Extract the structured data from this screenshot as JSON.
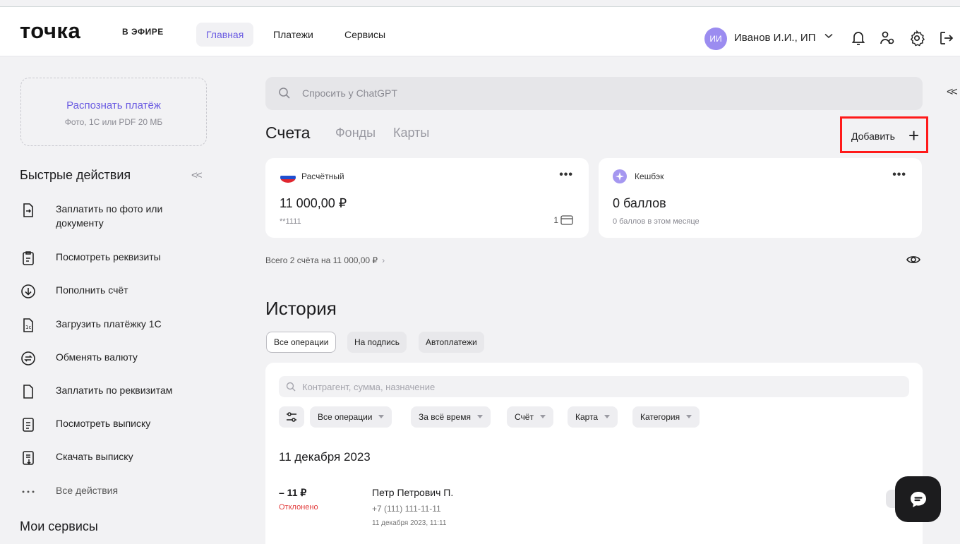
{
  "header": {
    "logo": "точка",
    "on_air": "В ЭФИРЕ",
    "tabs": [
      {
        "label": "Главная",
        "active": true
      },
      {
        "label": "Платежи",
        "active": false
      },
      {
        "label": "Сервисы",
        "active": false
      }
    ],
    "user": {
      "initials": "ИИ",
      "name": "Иванов И.И., ИП"
    },
    "icons": [
      "bell-icon",
      "users-icon",
      "gear-icon",
      "logout-icon"
    ]
  },
  "sidebar": {
    "recognize": {
      "title": "Распознать платёж",
      "subtitle": "Фото, 1С или PDF 20 МБ"
    },
    "quick_actions_title": "Быстрые действия",
    "quick_actions": [
      {
        "label": "Заплатить по фото или документу",
        "icon": "scan-document-icon"
      },
      {
        "label": "Посмотреть реквизиты",
        "icon": "clipboard-icon"
      },
      {
        "label": "Пополнить счёт",
        "icon": "arrow-down-circle-icon"
      },
      {
        "label": "Загрузить платёжку 1С",
        "icon": "file-1c-icon"
      },
      {
        "label": "Обменять валюту",
        "icon": "exchange-icon"
      },
      {
        "label": "Заплатить по реквизитам",
        "icon": "file-icon"
      },
      {
        "label": "Посмотреть выписку",
        "icon": "statement-icon"
      },
      {
        "label": "Скачать выписку",
        "icon": "download-statement-icon"
      },
      {
        "label": "Все действия",
        "icon": "dots-icon"
      }
    ],
    "my_services_title": "Мои сервисы"
  },
  "main": {
    "search_placeholder": "Спросить у ChatGPT",
    "account_tabs": [
      {
        "label": "Счета",
        "active": true
      },
      {
        "label": "Фонды",
        "active": false
      },
      {
        "label": "Карты",
        "active": false
      }
    ],
    "add_label": "Добавить",
    "cards": [
      {
        "name": "Расчётный",
        "amount": "11 000,00 ₽",
        "sub": "**1111",
        "cards_count": "1"
      },
      {
        "name": "Кешбэк",
        "amount": "0 баллов",
        "sub": "0 баллов в этом месяце"
      }
    ],
    "total_line": "Всего 2 счёта на 11 000,00 ₽",
    "history": {
      "title": "История",
      "chips": [
        {
          "label": "Все операции",
          "active": true
        },
        {
          "label": "На подпись",
          "active": false
        },
        {
          "label": "Автоплатежи",
          "active": false
        }
      ],
      "search_placeholder": "Контрагент, сумма, назначение",
      "filters": [
        "Все операции",
        "За всё время",
        "Счёт",
        "Карта",
        "Категория"
      ],
      "date_heading": "11 декабря 2023",
      "operations": [
        {
          "amount": "– 11 ₽",
          "status": "Отклонено",
          "counterparty": "Петр Петрович П.",
          "phone": "+7 (111) 111-11-11",
          "datetime": "11 декабря 2023, 11:11"
        }
      ]
    }
  },
  "colors": {
    "accent": "#6a5be2",
    "highlight": "#ff1a1a",
    "declined": "#e23b3b"
  }
}
